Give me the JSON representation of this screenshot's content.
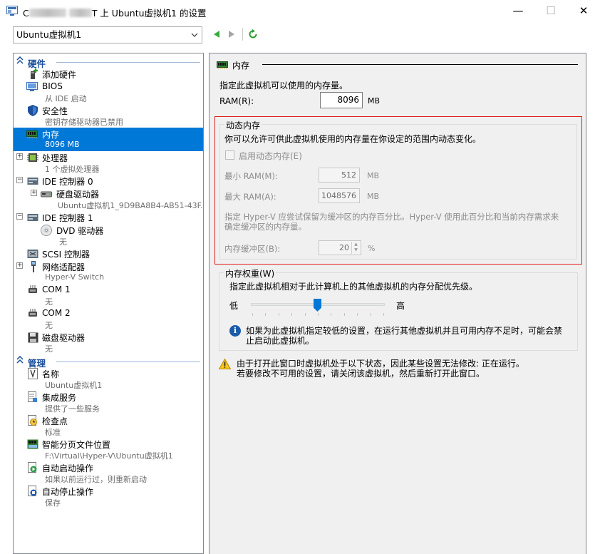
{
  "window": {
    "title_prefix": "C",
    "title_mid": "T 上 Ubuntu虚拟机1 的设置",
    "minimize": "—",
    "maximize": "☐",
    "close": "✕"
  },
  "toolbar": {
    "vm_selected": "Ubuntu虚拟机1",
    "back_icon": "back-arrow-icon",
    "forward_icon": "forward-arrow-icon",
    "refresh_icon": "refresh-icon"
  },
  "tree": {
    "hardware_header": "硬件",
    "management_header": "管理",
    "hardware_items": [
      {
        "name": "添加硬件",
        "sub": ""
      },
      {
        "name": "BIOS",
        "sub": "从 IDE 启动"
      },
      {
        "name": "安全性",
        "sub": "密钥存储驱动器已禁用"
      },
      {
        "name": "内存",
        "sub": "8096 MB"
      },
      {
        "name": "处理器",
        "sub": "1 个虚拟处理器"
      },
      {
        "name": "IDE 控制器 0",
        "sub": ""
      },
      {
        "name": "硬盘驱动器",
        "sub": "Ubuntu虚拟机1_9D9BA8B4-AB51-43F..."
      },
      {
        "name": "IDE 控制器 1",
        "sub": ""
      },
      {
        "name": "DVD 驱动器",
        "sub": "无"
      },
      {
        "name": "SCSI 控制器",
        "sub": ""
      },
      {
        "name": "网络适配器",
        "sub": "Hyper-V Switch"
      },
      {
        "name": "COM 1",
        "sub": "无"
      },
      {
        "name": "COM 2",
        "sub": "无"
      },
      {
        "name": "磁盘驱动器",
        "sub": "无"
      }
    ],
    "management_items": [
      {
        "name": "名称",
        "sub": "Ubuntu虚拟机1"
      },
      {
        "name": "集成服务",
        "sub": "提供了一些服务"
      },
      {
        "name": "检查点",
        "sub": "标准"
      },
      {
        "name": "智能分页文件位置",
        "sub": "F:\\Virtual\\Hyper-V\\Ubuntu虚拟机1"
      },
      {
        "name": "自动启动操作",
        "sub": "如果以前运行过，则重新启动"
      },
      {
        "name": "自动停止操作",
        "sub": "保存"
      }
    ]
  },
  "memory": {
    "header": "内存",
    "description": "指定此虚拟机可以使用的内存量。",
    "ram_label": "RAM(R):",
    "ram_value": "8096",
    "ram_unit": "MB"
  },
  "dynamic": {
    "title": "动态内存",
    "description": "你可以允许可供此虚拟机使用的内存量在你设定的范围内动态变化。",
    "enable_label": "启用动态内存(E)",
    "enabled": false,
    "min_label": "最小 RAM(M):",
    "min_value": "512",
    "min_unit": "MB",
    "max_label": "最大 RAM(A):",
    "max_value": "1048576",
    "max_unit": "MB",
    "buffer_desc_1": "指定 Hyper-V 应尝试保留为缓冲区的内存百分比。Hyper-V 使用此百分比和当前内存需求来",
    "buffer_desc_2": "确定缓冲区的内存量。",
    "buffer_label": "内存缓冲区(B):",
    "buffer_value": "20",
    "buffer_unit": "%"
  },
  "weight": {
    "title": "内存权重(W)",
    "description": "指定此虚拟机相对于此计算机上的其他虚拟机的内存分配优先级。",
    "low": "低",
    "high": "高",
    "slider_level": 0.5,
    "info_1": "如果为此虚拟机指定较低的设置，在运行其他虚拟机并且可用内存不足时，可能会禁",
    "info_2": "止启动此虚拟机。"
  },
  "warning": {
    "line_1": "由于打开此窗口时虚拟机处于以下状态，因此某些设置无法修改: 正在运行。",
    "line_2": "若要修改不可用的设置，请关闭该虚拟机，然后重新打开此窗口。"
  },
  "colors": {
    "accent": "#0078d7",
    "highlight_box": "#e02020",
    "header_blue": "#1b4f9c"
  }
}
